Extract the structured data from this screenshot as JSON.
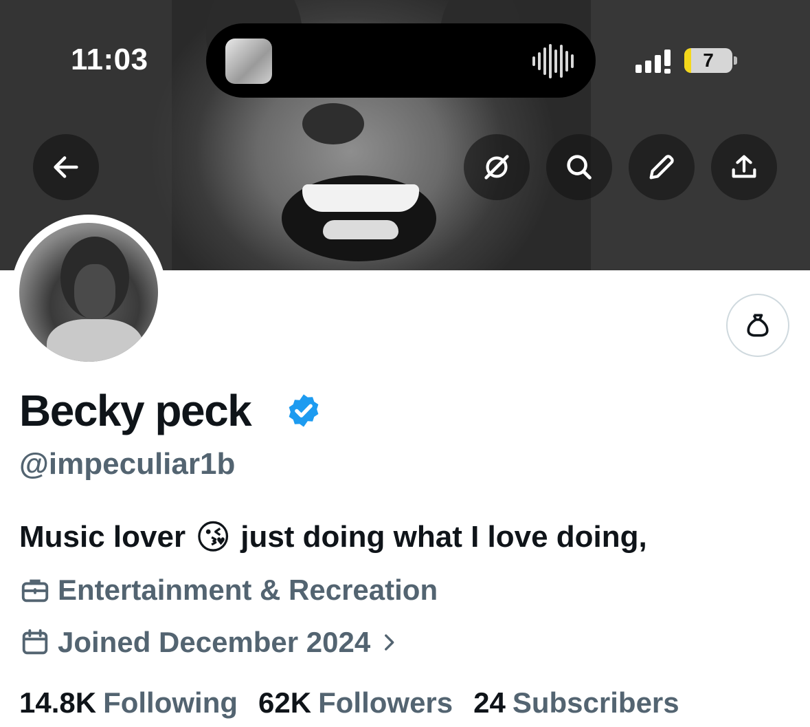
{
  "status_bar": {
    "time": "11:03",
    "battery_level": "7",
    "accent_color": "#f4d81a"
  },
  "header_actions": {
    "back_icon": "arrow-left-icon",
    "grok_icon": "grok-icon",
    "search_icon": "search-icon",
    "edit_icon": "pencil-icon",
    "share_icon": "share-upload-icon",
    "gift_icon": "money-bag-icon"
  },
  "profile": {
    "name": "Becky peck",
    "verified_color": "#1d9bf0",
    "handle": "@impeculiar1b",
    "bio_start": "Music lover",
    "bio_emoji": "😘",
    "bio_end": "just doing what I love doing,",
    "category": "Entertainment & Recreation",
    "joined": "Joined December 2024"
  },
  "stats": {
    "following_count": "14.8K",
    "following_label": "Following",
    "followers_count": "62K",
    "followers_label": "Followers",
    "subscribers_count": "24",
    "subscribers_label": "Subscribers"
  }
}
